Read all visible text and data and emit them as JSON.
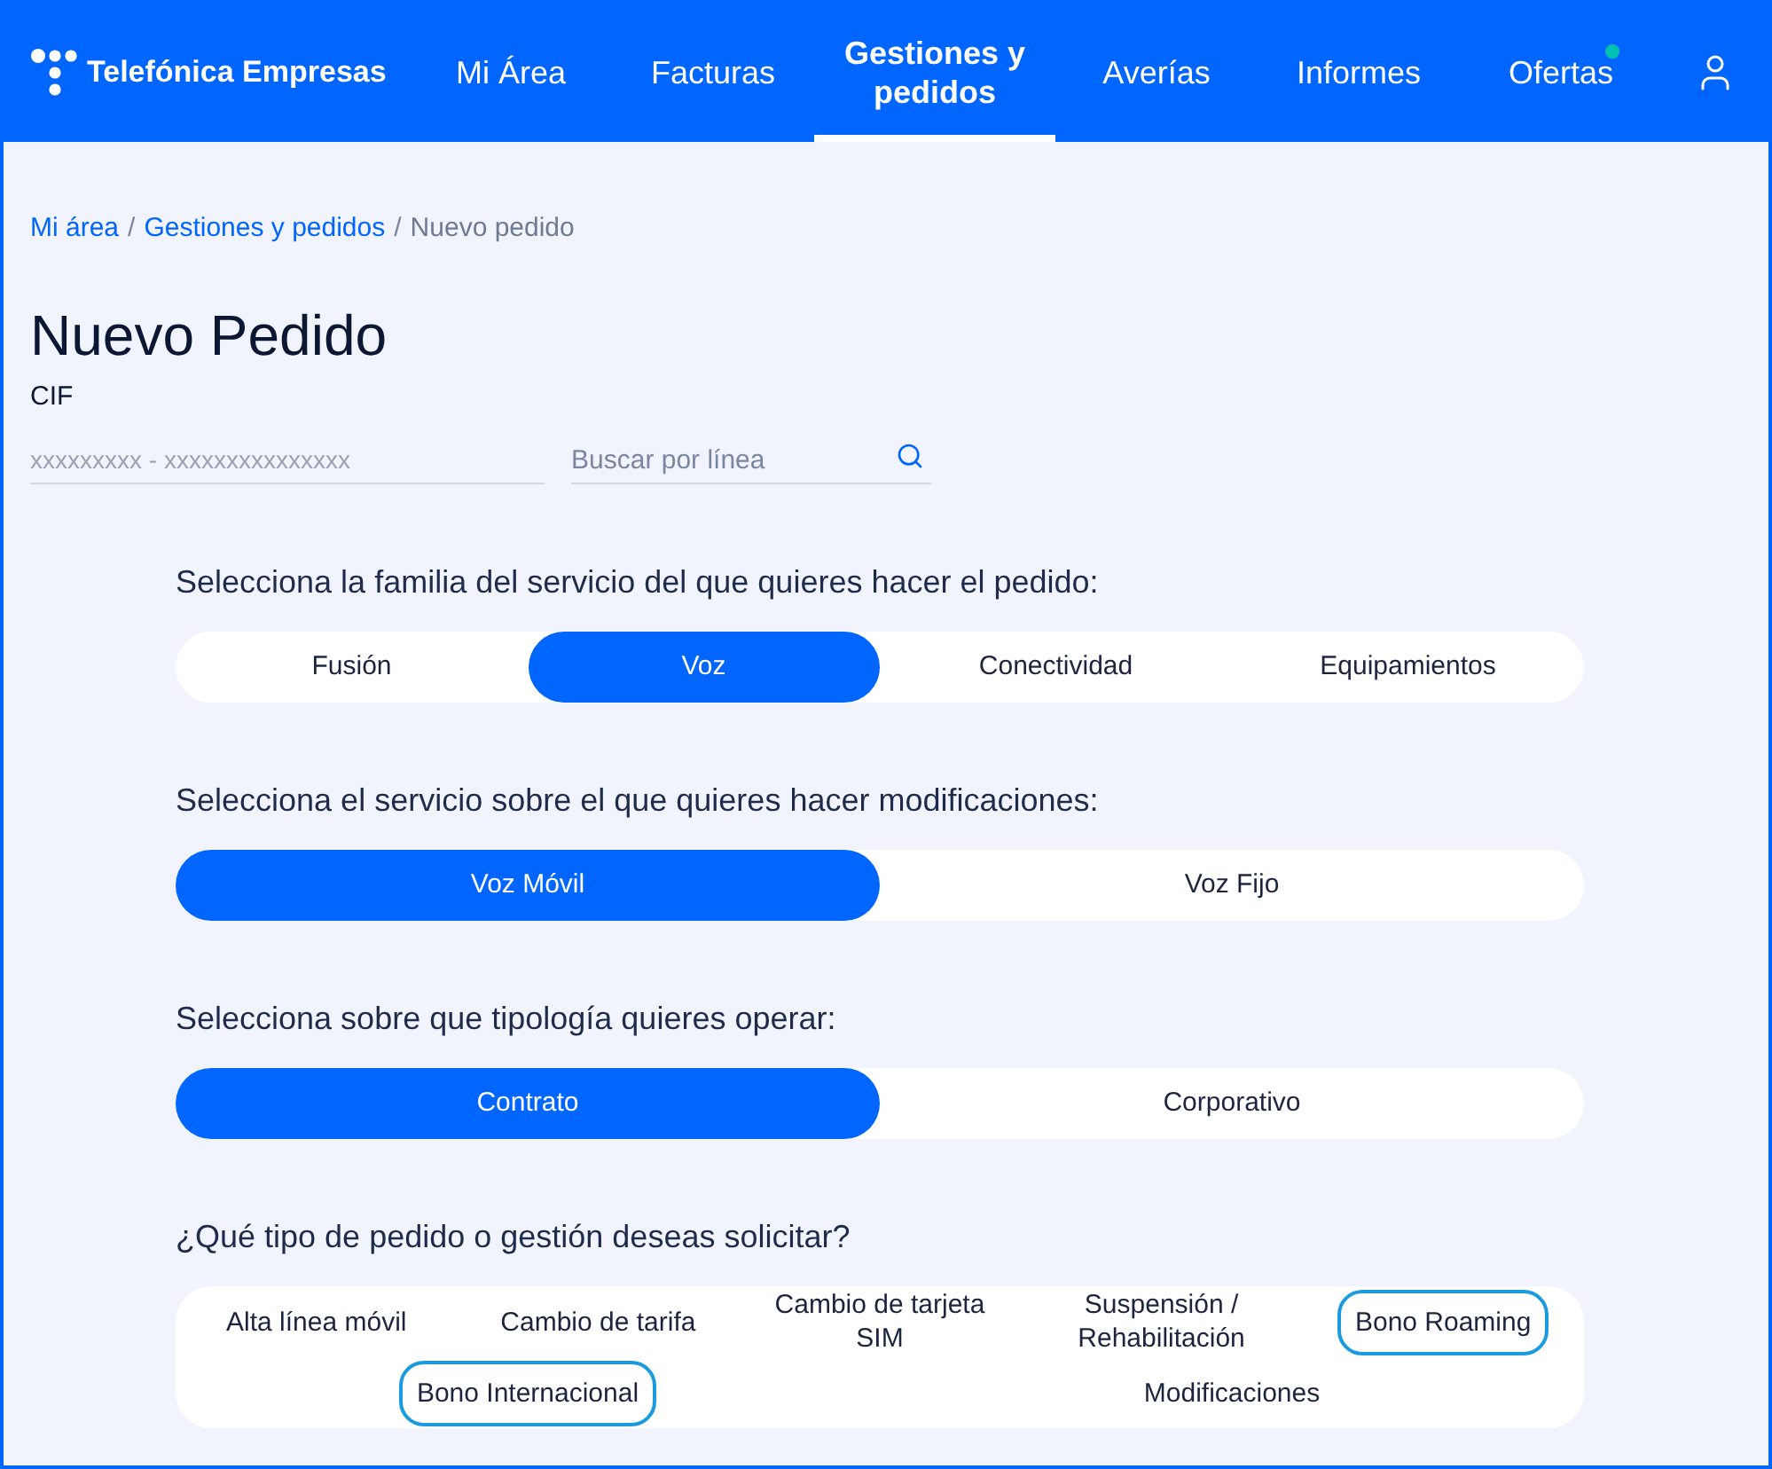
{
  "header": {
    "logo": "Telefónica Empresas",
    "nav": [
      {
        "label": "Mi Área",
        "selected": false,
        "notification": false
      },
      {
        "label": "Facturas",
        "selected": false,
        "notification": false
      },
      {
        "label": "Gestiones y pedidos",
        "selected": true,
        "notification": false
      },
      {
        "label": "Averías",
        "selected": false,
        "notification": false
      },
      {
        "label": "Informes",
        "selected": false,
        "notification": false
      },
      {
        "label": "Ofertas",
        "selected": false,
        "notification": true
      }
    ]
  },
  "breadcrumb": [
    {
      "label": "Mi área",
      "current": false
    },
    {
      "separator": "/",
      "label": "Gestiones y pedidos",
      "current": false
    },
    {
      "separator": "/",
      "label": "Nuevo pedido",
      "current": true
    }
  ],
  "title": "Nuevo Pedido",
  "cif": {
    "label": "CIF",
    "placeholder": "xxxxxxxxx - xxxxxxxxxxxxxxx"
  },
  "search": {
    "placeholder": "Buscar por línea"
  },
  "sections": [
    {
      "kind": "segmented",
      "question": "Selecciona la familia del servicio del que quieres hacer el pedido:",
      "options": [
        {
          "label": "Fusión",
          "selected": false
        },
        {
          "label": "Voz",
          "selected": true
        },
        {
          "label": "Conectividad",
          "selected": false
        },
        {
          "label": "Equipamientos",
          "selected": false
        }
      ]
    },
    {
      "kind": "segmented",
      "question": "Selecciona el servicio sobre el que quieres hacer modificaciones:",
      "options": [
        {
          "label": "Voz Móvil",
          "selected": true
        },
        {
          "label": "Voz Fijo",
          "selected": false
        }
      ]
    },
    {
      "kind": "segmented",
      "question": "Selecciona sobre que tipología quieres operar:",
      "options": [
        {
          "label": "Contrato",
          "selected": true
        },
        {
          "label": "Corporativo",
          "selected": false
        }
      ]
    },
    {
      "kind": "grid",
      "question": "¿Qué tipo de pedido o gestión deseas solicitar?",
      "rows": [
        {
          "options": [
            {
              "label": "Alta línea móvil",
              "highlighted": false
            },
            {
              "label": "Cambio de tarifa",
              "highlighted": false
            },
            {
              "label": "Cambio de tarjeta SIM",
              "highlighted": false
            },
            {
              "label": "Suspensión / Rehabilitación",
              "highlighted": false
            },
            {
              "label": "Bono Roaming",
              "highlighted": true
            }
          ]
        },
        {
          "options": [
            {
              "label": "Bono Internacional",
              "highlighted": true
            },
            {
              "label": "Modificaciones",
              "highlighted": false
            }
          ]
        }
      ]
    }
  ]
}
